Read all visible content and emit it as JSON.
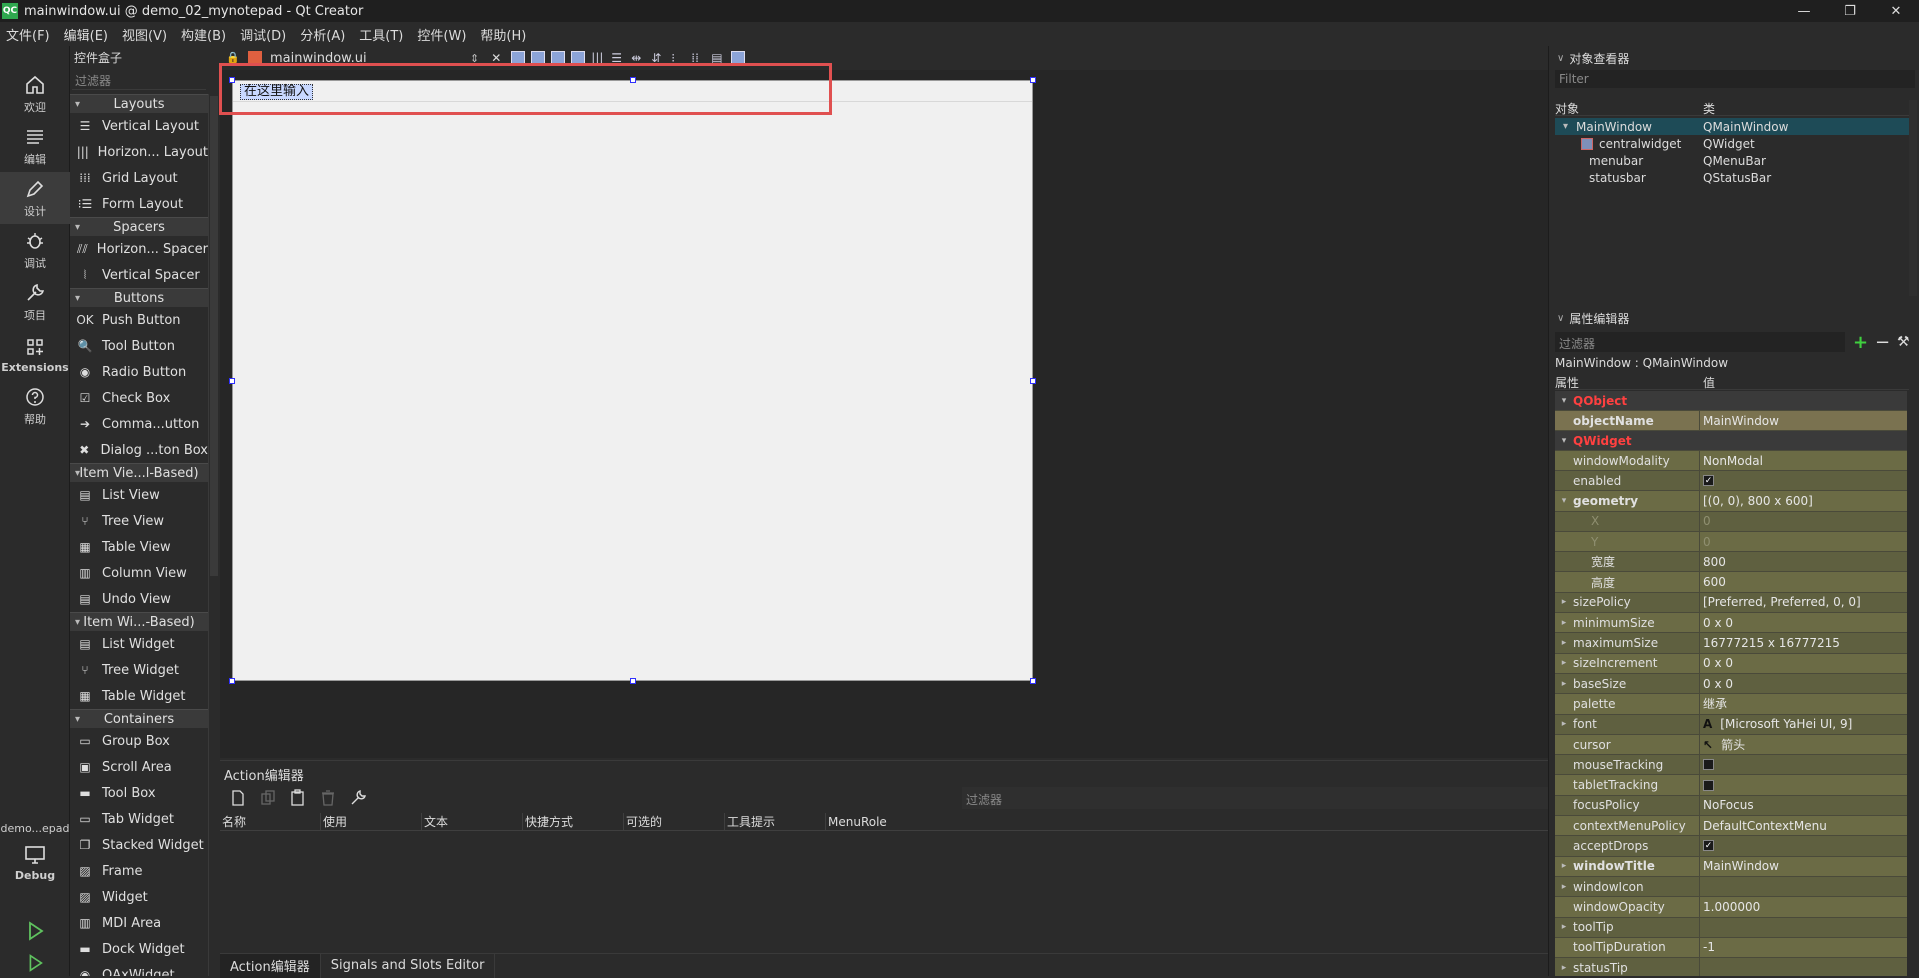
{
  "window": {
    "title": "mainwindow.ui @ demo_02_mynotepad - Qt Creator",
    "logo": "QC",
    "minimize": "—",
    "maximize": "❐",
    "close": "✕"
  },
  "menubar": [
    "文件(F)",
    "编辑(E)",
    "视图(V)",
    "构建(B)",
    "调试(D)",
    "分析(A)",
    "工具(T)",
    "控件(W)",
    "帮助(H)"
  ],
  "modes": {
    "welcome": "欢迎",
    "edit": "编辑",
    "design": "设计",
    "debug": "调试",
    "project": "项目",
    "extensions": "Extensions",
    "help": "帮助",
    "kit_project": "demo...epad",
    "kit_config": "Debug"
  },
  "widget_box": {
    "title": "控件盒子",
    "filter_placeholder": "过滤器",
    "categories": [
      {
        "name": "Layouts",
        "items": [
          {
            "icon": "vertical-layout-icon",
            "glyph": "☰",
            "label": "Vertical Layout"
          },
          {
            "icon": "horizontal-layout-icon",
            "glyph": "|||",
            "label": "Horizon... Layout"
          },
          {
            "icon": "grid-layout-icon",
            "glyph": "⁞⁞⁞",
            "label": "Grid Layout"
          },
          {
            "icon": "form-layout-icon",
            "glyph": "⁝☰",
            "label": "Form Layout"
          }
        ]
      },
      {
        "name": "Spacers",
        "items": [
          {
            "icon": "horizontal-spacer-icon",
            "glyph": "⫽⫽",
            "label": "Horizon... Spacer"
          },
          {
            "icon": "vertical-spacer-icon",
            "glyph": "⦚",
            "label": "Vertical Spacer"
          }
        ]
      },
      {
        "name": "Buttons",
        "items": [
          {
            "icon": "push-button-icon",
            "glyph": "OK",
            "label": "Push Button"
          },
          {
            "icon": "tool-button-icon",
            "glyph": "🔍",
            "label": "Tool Button"
          },
          {
            "icon": "radio-button-icon",
            "glyph": "◉",
            "label": "Radio Button"
          },
          {
            "icon": "check-box-icon",
            "glyph": "☑",
            "label": "Check Box"
          },
          {
            "icon": "command-link-button-icon",
            "glyph": "➔",
            "label": "Comma...utton"
          },
          {
            "icon": "dialog-button-box-icon",
            "glyph": "✖",
            "label": "Dialog ...ton Box"
          }
        ]
      },
      {
        "name": "Item Vie...l-Based)",
        "items": [
          {
            "icon": "list-view-icon",
            "glyph": "▤",
            "label": "List View"
          },
          {
            "icon": "tree-view-icon",
            "glyph": "⑂",
            "label": "Tree View"
          },
          {
            "icon": "table-view-icon",
            "glyph": "▦",
            "label": "Table View"
          },
          {
            "icon": "column-view-icon",
            "glyph": "▥",
            "label": "Column View"
          },
          {
            "icon": "undo-view-icon",
            "glyph": "▤",
            "label": "Undo View"
          }
        ]
      },
      {
        "name": "Item Wi...-Based)",
        "items": [
          {
            "icon": "list-widget-icon",
            "glyph": "▤",
            "label": "List Widget"
          },
          {
            "icon": "tree-widget-icon",
            "glyph": "⑂",
            "label": "Tree Widget"
          },
          {
            "icon": "table-widget-icon",
            "glyph": "▦",
            "label": "Table Widget"
          }
        ]
      },
      {
        "name": "Containers",
        "items": [
          {
            "icon": "group-box-icon",
            "glyph": "▭",
            "label": "Group Box"
          },
          {
            "icon": "scroll-area-icon",
            "glyph": "▣",
            "label": "Scroll Area"
          },
          {
            "icon": "tool-box-icon",
            "glyph": "▬",
            "label": "Tool Box"
          },
          {
            "icon": "tab-widget-icon",
            "glyph": "▭",
            "label": "Tab Widget"
          },
          {
            "icon": "stacked-widget-icon",
            "glyph": "❐",
            "label": "Stacked Widget"
          },
          {
            "icon": "frame-icon",
            "glyph": "▨",
            "label": "Frame"
          },
          {
            "icon": "widget-icon",
            "glyph": "▨",
            "label": "Widget"
          },
          {
            "icon": "mdi-area-icon",
            "glyph": "▥",
            "label": "MDI Area"
          },
          {
            "icon": "dock-widget-icon",
            "glyph": "▬",
            "label": "Dock Widget"
          },
          {
            "icon": "qaxwidget-icon",
            "glyph": "◉",
            "label": "QAxWidget"
          }
        ]
      }
    ]
  },
  "editor": {
    "file_name": "mainwindow.ui",
    "menu_placeholder": "在这里输入"
  },
  "action_editor": {
    "title": "Action编辑器",
    "filter_placeholder": "过滤器",
    "columns": [
      "名称",
      "使用",
      "文本",
      "快捷方式",
      "可选的",
      "工具提示",
      "MenuRole"
    ],
    "tabs": [
      "Action编辑器",
      "Signals and Slots Editor"
    ]
  },
  "object_inspector": {
    "title": "对象查看器",
    "filter_placeholder": "Filter",
    "columns": [
      "对象",
      "类"
    ],
    "rows": [
      {
        "name": "MainWindow",
        "cls": "QMainWindow",
        "selected": true
      },
      {
        "name": "centralwidget",
        "cls": "QWidget"
      },
      {
        "name": "menubar",
        "cls": "QMenuBar"
      },
      {
        "name": "statusbar",
        "cls": "QStatusBar"
      }
    ]
  },
  "property_editor": {
    "title": "属性编辑器",
    "filter_placeholder": "过滤器",
    "class_label": "MainWindow : QMainWindow",
    "columns": [
      "属性",
      "值"
    ],
    "rows": [
      {
        "kind": "grp",
        "name": "QObject"
      },
      {
        "kind": "hl",
        "name": "objectName",
        "value": "MainWindow",
        "bold": true
      },
      {
        "kind": "grp",
        "name": "QWidget"
      },
      {
        "name": "windowModality",
        "value": "NonModal"
      },
      {
        "name": "enabled",
        "check": true
      },
      {
        "name": "geometry",
        "value": "[(0, 0), 800 x 600]",
        "bold": true,
        "expand": "open"
      },
      {
        "name": "X",
        "value": "0",
        "sub": true,
        "dim": true
      },
      {
        "name": "Y",
        "value": "0",
        "sub": true,
        "dim": true
      },
      {
        "name": "宽度",
        "value": "800",
        "sub": true
      },
      {
        "name": "高度",
        "value": "600",
        "sub": true
      },
      {
        "name": "sizePolicy",
        "value": "[Preferred, Preferred, 0, 0]",
        "expand": "closed"
      },
      {
        "name": "minimumSize",
        "value": "0 x 0",
        "expand": "closed"
      },
      {
        "name": "maximumSize",
        "value": "16777215 x 16777215",
        "expand": "closed"
      },
      {
        "name": "sizeIncrement",
        "value": "0 x 0",
        "expand": "closed"
      },
      {
        "name": "baseSize",
        "value": "0 x 0",
        "expand": "closed"
      },
      {
        "name": "palette",
        "value": "继承"
      },
      {
        "name": "font",
        "value": "[Microsoft YaHei UI, 9]",
        "prefix": "A",
        "expand": "closed"
      },
      {
        "name": "cursor",
        "value": "箭头",
        "prefix": "↖"
      },
      {
        "name": "mouseTracking",
        "check": false
      },
      {
        "name": "tabletTracking",
        "check": false
      },
      {
        "name": "focusPolicy",
        "value": "NoFocus"
      },
      {
        "name": "contextMenuPolicy",
        "value": "DefaultContextMenu"
      },
      {
        "name": "acceptDrops",
        "check": true
      },
      {
        "name": "windowTitle",
        "value": "MainWindow",
        "bold": true,
        "expand": "closed"
      },
      {
        "name": "windowIcon",
        "value": "",
        "expand": "closed"
      },
      {
        "name": "windowOpacity",
        "value": "1.000000"
      },
      {
        "name": "toolTip",
        "value": "",
        "expand": "closed"
      },
      {
        "name": "toolTipDuration",
        "value": "-1"
      },
      {
        "name": "statusTip",
        "value": "",
        "expand": "closed"
      }
    ]
  }
}
